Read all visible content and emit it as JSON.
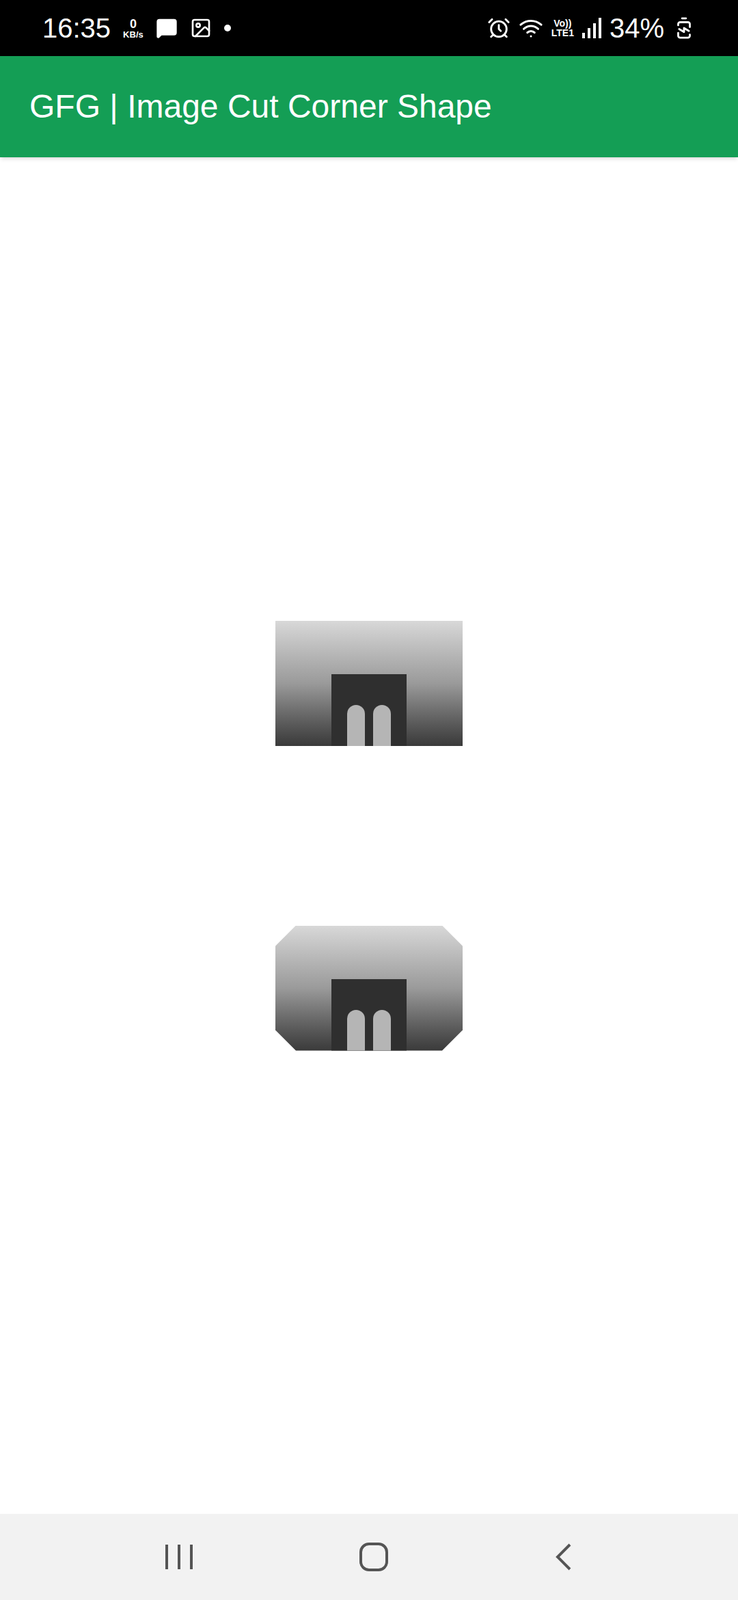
{
  "status_bar": {
    "time": "16:35",
    "network_speed": "0",
    "network_unit": "KB/s",
    "volte": "Vo))",
    "lte": "LTE1",
    "battery": "34%"
  },
  "app_bar": {
    "title": "GFG | Image Cut Corner Shape"
  },
  "images": [
    {
      "kind": "rectangle"
    },
    {
      "kind": "cut-corner"
    }
  ]
}
